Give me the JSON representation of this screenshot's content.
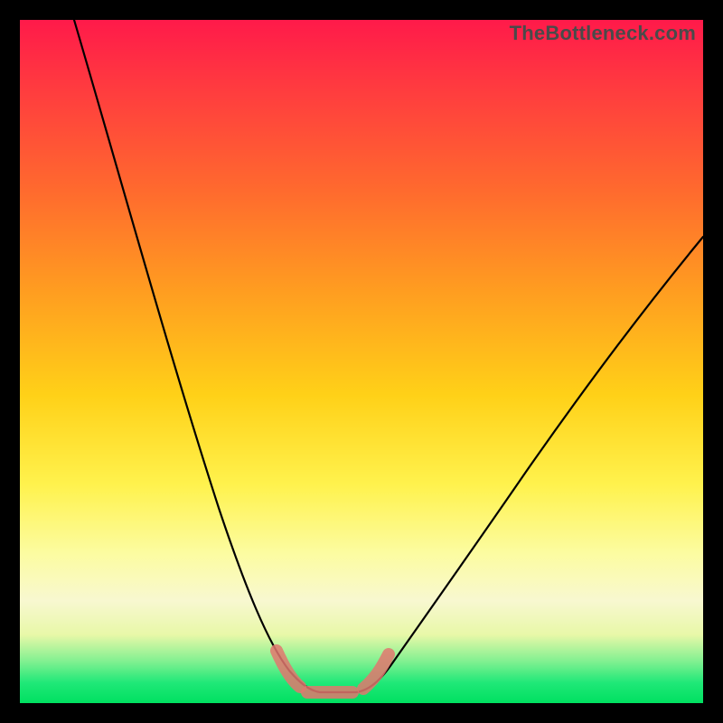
{
  "watermark": "TheBottleneck.com",
  "colors": {
    "frame": "#000000",
    "grad_top": "#ff1a4a",
    "grad_mid": "#fff24d",
    "grad_bottom": "#00e060",
    "curve": "#000000",
    "bracket": "#e2776e"
  },
  "chart_data": {
    "type": "line",
    "title": "",
    "xlabel": "",
    "ylabel": "",
    "xlim": [
      0,
      100
    ],
    "ylim": [
      0,
      100
    ],
    "series": [
      {
        "name": "bottleneck-curve",
        "x": [
          8,
          12,
          16,
          20,
          24,
          28,
          32,
          36,
          38,
          40,
          42,
          44,
          46,
          48,
          50,
          54,
          60,
          68,
          76,
          84,
          92,
          100
        ],
        "y": [
          100,
          88,
          76,
          64,
          52,
          40,
          28,
          16,
          10,
          6,
          3,
          1,
          1,
          1,
          2,
          5,
          11,
          20,
          30,
          40,
          50,
          60
        ]
      }
    ],
    "annotations": [
      {
        "name": "optimal-bracket",
        "x_range": [
          36,
          50
        ],
        "y": 1
      }
    ]
  }
}
